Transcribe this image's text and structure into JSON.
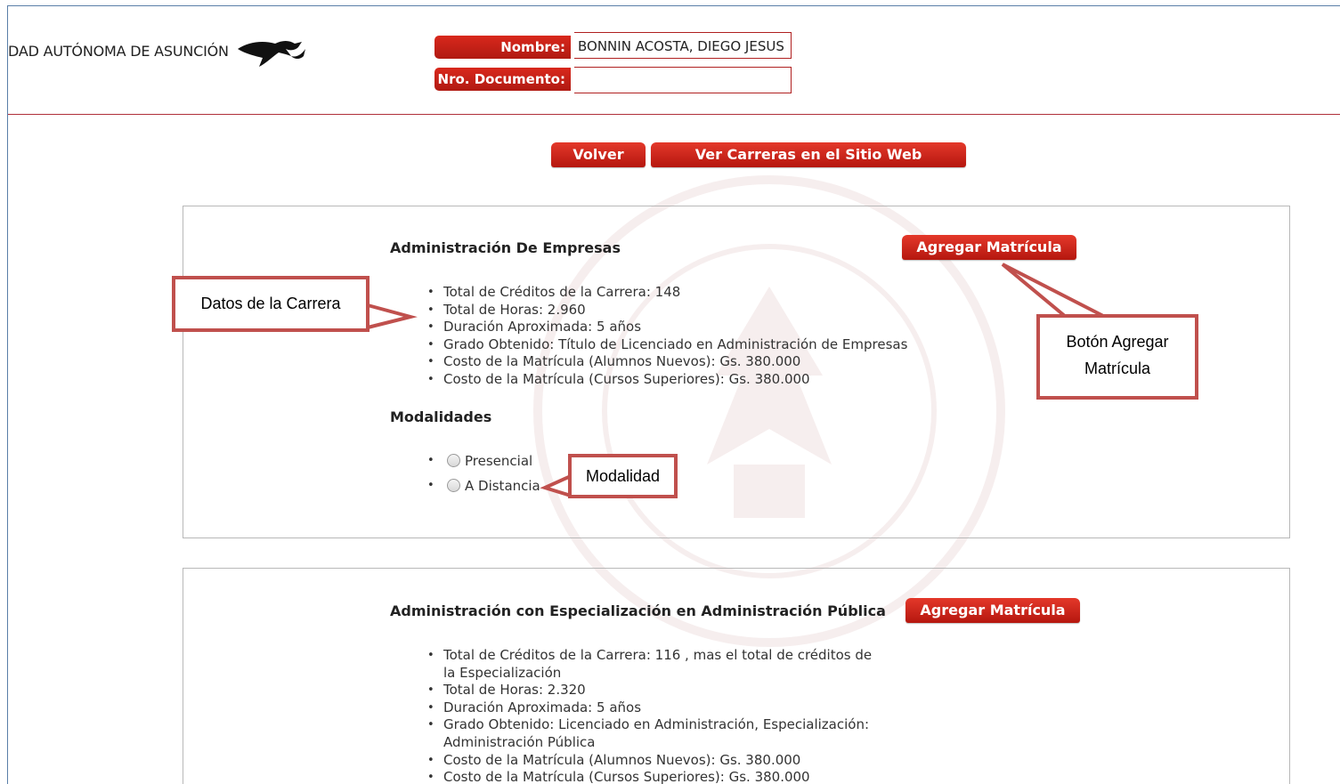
{
  "header": {
    "university_name": "DAD AUTÓNOMA DE ASUNCIÓN",
    "nombre_label": "Nombre:",
    "nombre_value": "BONNIN ACOSTA, DIEGO JESUS",
    "documento_label": "Nro. Documento:",
    "documento_value": ""
  },
  "toolbar": {
    "volver_label": "Volver",
    "ver_carreras_label": "Ver Carreras en el Sitio Web"
  },
  "careers": [
    {
      "title": "Administración De Empresas",
      "add_button": "Agregar Matrícula",
      "info": [
        "Total de Créditos de la Carrera: 148",
        "Total de Horas: 2.960",
        "Duración Aproximada: 5 años",
        "Grado Obtenido: Título de Licenciado en Administración de Empresas",
        "Costo de la Matrícula (Alumnos Nuevos): Gs. 380.000",
        "Costo de la Matrícula (Cursos Superiores): Gs. 380.000"
      ],
      "modalidades_title": "Modalidades",
      "modalidades": [
        "Presencial",
        "A Distancia"
      ]
    },
    {
      "title": "Administración con Especialización en Administración Pública",
      "add_button": "Agregar Matrícula",
      "info": [
        "Total de Créditos de la Carrera: 116 , mas el total de créditos de la Especialización",
        "Total de Horas: 2.320",
        "Duración Aproximada: 5 años",
        "Grado Obtenido: Licenciado en Administración, Especialización: Administración Pública",
        "Costo de la Matrícula (Alumnos Nuevos): Gs. 380.000",
        "Costo de la Matrícula (Cursos Superiores): Gs. 380.000"
      ]
    }
  ],
  "callouts": {
    "datos": "Datos de la Carrera",
    "boton_line1": "Botón Agregar",
    "boton_line2": "Matrícula",
    "modalidad": "Modalidad"
  },
  "colors": {
    "accent_red": "#c4231a",
    "callout_border": "#c0504d",
    "header_rule": "#b0303a"
  }
}
